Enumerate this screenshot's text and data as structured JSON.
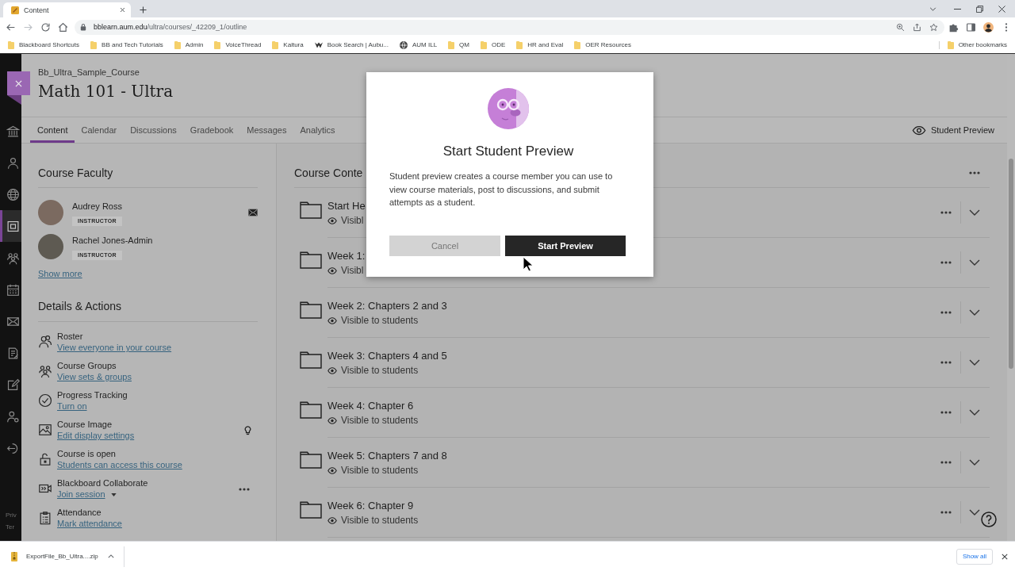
{
  "browser": {
    "tab": {
      "title": "Content"
    },
    "address": {
      "host": "bblearn.aum.edu",
      "path": "/ultra/courses/_42209_1/outline"
    },
    "bookmarks": [
      {
        "label": "Blackboard Shortcuts",
        "kind": "folder"
      },
      {
        "label": "BB and Tech Tutorials",
        "kind": "folder"
      },
      {
        "label": "Admin",
        "kind": "folder"
      },
      {
        "label": "VoiceThread",
        "kind": "folder"
      },
      {
        "label": "Kaltura",
        "kind": "folder"
      },
      {
        "label": "Book Search | Aubu...",
        "kind": "site"
      },
      {
        "label": "AUM ILL",
        "kind": "globe"
      },
      {
        "label": "QM",
        "kind": "folder"
      },
      {
        "label": "ODE",
        "kind": "folder"
      },
      {
        "label": "HR and Eval",
        "kind": "folder"
      },
      {
        "label": "OER Resources",
        "kind": "folder"
      }
    ],
    "other_bookmarks": "Other bookmarks"
  },
  "nav_rail": {
    "items": [
      {
        "kind": "institution",
        "selected": false
      },
      {
        "kind": "person",
        "selected": false
      },
      {
        "kind": "globe",
        "selected": false
      },
      {
        "kind": "courses",
        "selected": true
      },
      {
        "kind": "groups",
        "selected": false
      },
      {
        "kind": "calendar",
        "selected": false
      },
      {
        "kind": "mail",
        "selected": false
      },
      {
        "kind": "grades",
        "selected": false
      },
      {
        "kind": "edit",
        "selected": false
      },
      {
        "kind": "person-gear",
        "selected": false
      },
      {
        "kind": "sign-out",
        "selected": false
      }
    ],
    "footer_links": [
      "Priv",
      "Ter"
    ]
  },
  "course": {
    "breadcrumb": "Bb_Ultra_Sample_Course",
    "title": "Math 101 - Ultra"
  },
  "tabs": [
    {
      "label": "Content",
      "selected": true
    },
    {
      "label": "Calendar",
      "selected": false
    },
    {
      "label": "Discussions",
      "selected": false
    },
    {
      "label": "Gradebook",
      "selected": false
    },
    {
      "label": "Messages",
      "selected": false
    },
    {
      "label": "Analytics",
      "selected": false
    }
  ],
  "student_preview": {
    "label": "Student Preview"
  },
  "faculty": {
    "heading": "Course Faculty",
    "members": [
      {
        "name": "Audrey Ross",
        "role": "INSTRUCTOR",
        "hovered": true
      },
      {
        "name": "Rachel Jones-Admin",
        "role": "INSTRUCTOR"
      }
    ],
    "show_more": "Show more"
  },
  "details": {
    "heading": "Details & Actions",
    "items": [
      {
        "kind": "roster",
        "label": "Roster",
        "link": "View everyone in your course"
      },
      {
        "kind": "groups",
        "label": "Course Groups",
        "link": "View sets & groups"
      },
      {
        "kind": "progress",
        "label": "Progress Tracking",
        "link": "Turn on"
      },
      {
        "kind": "image",
        "label": "Course Image",
        "link": "Edit display settings",
        "action": {
          "kind": "lightbulb"
        }
      },
      {
        "kind": "access",
        "label": "Course is open",
        "link": "Students can access this course"
      },
      {
        "kind": "collaborate",
        "label": "Blackboard Collaborate",
        "link": "Join session",
        "dropdown": true,
        "action": {
          "kind": "more"
        }
      },
      {
        "kind": "attendance",
        "label": "Attendance",
        "link": "Mark attendance"
      }
    ]
  },
  "content": {
    "heading": "Course Conte",
    "items": [
      {
        "title": "Start He",
        "visibility": "Visibl"
      },
      {
        "title": "Week 1:",
        "visibility": "Visibl"
      },
      {
        "title": "Week 2: Chapters 2 and 3",
        "visibility": "Visible to students"
      },
      {
        "title": "Week 3: Chapters 4 and 5",
        "visibility": "Visible to students"
      },
      {
        "title": "Week 4: Chapter 6",
        "visibility": "Visible to students"
      },
      {
        "title": "Week 5: Chapters 7 and 8",
        "visibility": "Visible to students"
      },
      {
        "title": "Week 6: Chapter 9",
        "visibility": "Visible to students"
      }
    ]
  },
  "dialog": {
    "title": "Start Student Preview",
    "body": "Student preview creates a course member you can use to view course materials, post to discussions, and submit attempts as a student.",
    "buttons": [
      {
        "label": "Cancel",
        "kind": "cancel"
      },
      {
        "label": "Start Preview",
        "kind": "confirm"
      }
    ]
  },
  "downloads": {
    "file": "ExportFile_Bb_Ultra....zip",
    "show_all": "Show all"
  }
}
